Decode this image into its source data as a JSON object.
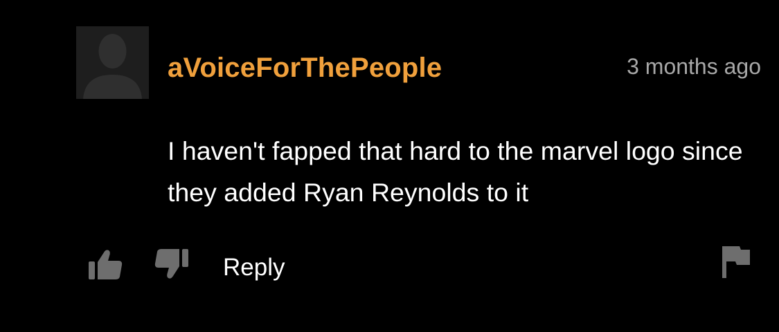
{
  "colors": {
    "background": "#000000",
    "username": "#f0a03c",
    "timestamp": "#a8a8a8",
    "body_text": "#ffffff",
    "icon": "#6e6e6e",
    "avatar_bg": "#1e1e1e",
    "avatar_silhouette": "#2f2f2f"
  },
  "comment": {
    "author": "aVoiceForThePeople",
    "timestamp": "3 months ago",
    "text": "I haven't fapped that hard to the marvel logo since they added Ryan Reynolds to it"
  },
  "actions": {
    "reply_label": "Reply",
    "icons": [
      "thumbs-up-icon",
      "thumbs-down-icon",
      "flag-icon"
    ]
  }
}
